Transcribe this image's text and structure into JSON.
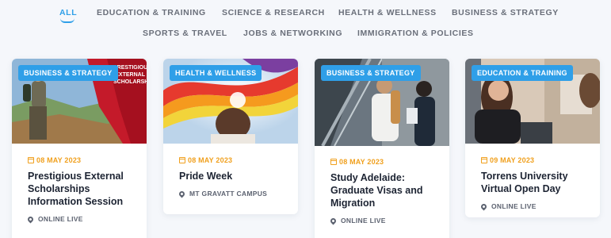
{
  "filters": {
    "row1": [
      "ALL",
      "EDUCATION & TRAINING",
      "SCIENCE & RESEARCH",
      "HEALTH & WELLNESS",
      "BUSINESS & STRATEGY"
    ],
    "row2": [
      "SPORTS & TRAVEL",
      "JOBS & NETWORKING",
      "IMMIGRATION & POLICIES"
    ],
    "active": "ALL"
  },
  "banner_text": [
    "PRESTIGIOUS",
    "EXTERNAL",
    "SCHOLARSHIPS"
  ],
  "events": [
    {
      "tag": "BUSINESS & STRATEGY",
      "date": "08 MAY 2023",
      "title": "Prestigious External Scholarships Information Session",
      "location": "ONLINE LIVE"
    },
    {
      "tag": "HEALTH & WELLNESS",
      "date": "08 MAY 2023",
      "title": "Pride Week",
      "location": "MT GRAVATT CAMPUS"
    },
    {
      "tag": "BUSINESS & STRATEGY",
      "date": "08 MAY 2023",
      "title": "Study Adelaide: Graduate Visas and Migration",
      "location": "ONLINE LIVE"
    },
    {
      "tag": "EDUCATION & TRAINING",
      "date": "09 MAY 2023",
      "title": "Torrens University Virtual Open Day",
      "location": "ONLINE LIVE"
    }
  ],
  "colors": {
    "accent": "#2f9fe8",
    "date": "#f0a01e",
    "title": "#1d2433"
  },
  "icons": {
    "date": "calendar-icon",
    "location": "map-pin-icon"
  }
}
